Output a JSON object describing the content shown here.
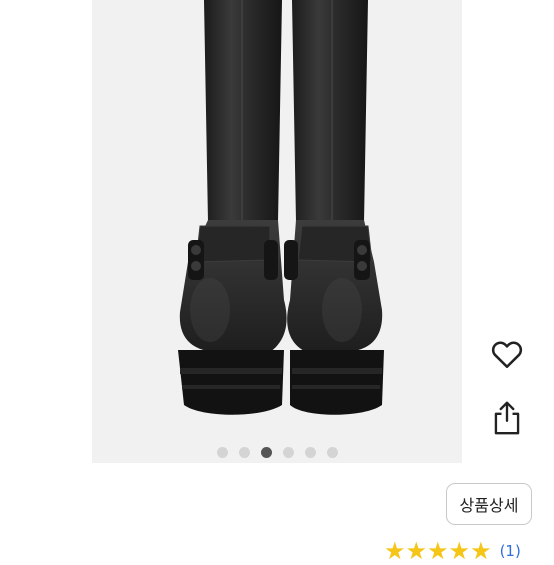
{
  "product": {
    "image": {
      "name": "black-biker-harness-boots-photo",
      "background_color": "#f1f1f1",
      "boot_color": "#2b2b2b"
    },
    "carousel": {
      "count": 6,
      "active_index": 2
    }
  },
  "actions": {
    "heart_icon": "heart-outline-icon",
    "share_icon": "share-icon",
    "detail_label": "상품상세"
  },
  "rating": {
    "stars": 5,
    "count_label": "(1)",
    "star_color": "#f5c518"
  }
}
